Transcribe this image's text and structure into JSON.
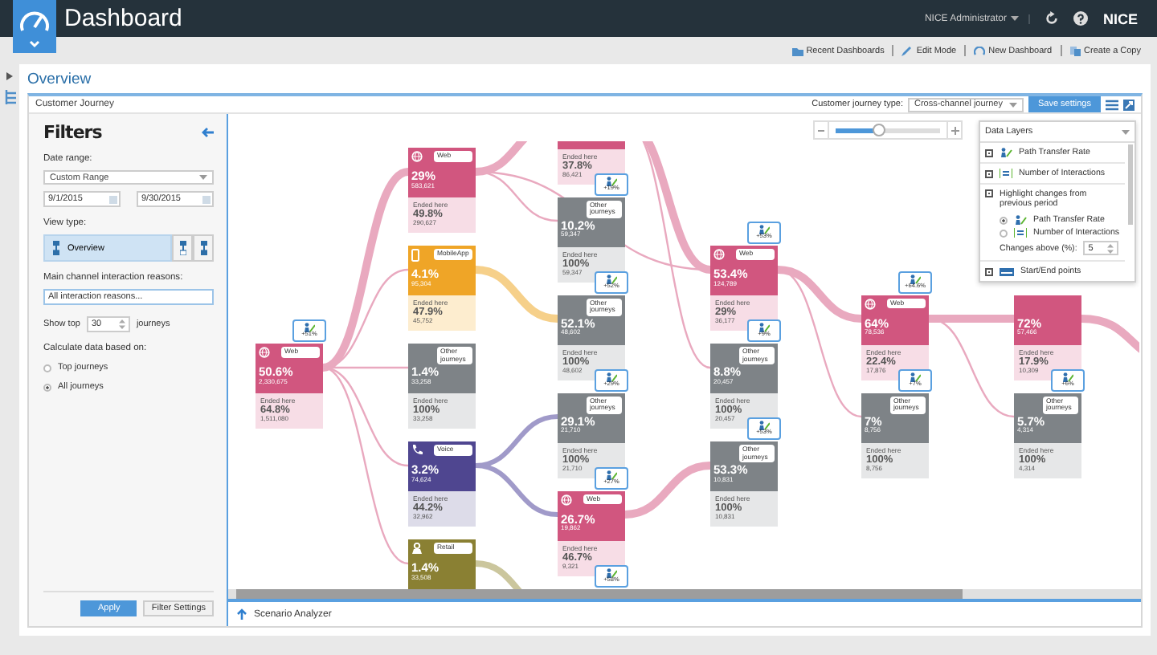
{
  "app": {
    "title": "Dashboard",
    "user": "NICE Administrator",
    "brand": "NICE"
  },
  "toolbar": [
    {
      "label": "Recent Dashboards"
    },
    {
      "label": "Edit Mode"
    },
    {
      "label": "New Dashboard"
    },
    {
      "label": "Create a Copy"
    }
  ],
  "page_title": "Overview",
  "panel": {
    "title": "Customer Journey",
    "type_label": "Customer journey type:",
    "type_value": "Cross-channel journey",
    "save": "Save settings"
  },
  "filters": {
    "title": "Filters",
    "date_label": "Date range:",
    "range": "Custom Range",
    "from": "9/1/2015",
    "to": "9/30/2015",
    "view_label": "View type:",
    "views": [
      {
        "label": "Overview",
        "selected": true
      },
      {
        "selected": false
      },
      {
        "selected": false
      }
    ],
    "reasons_label": "Main channel interaction reasons:",
    "reasons_value": "All interaction reasons...",
    "show_top": "Show top",
    "top_value": "30",
    "journeys": "journeys",
    "calc_label": "Calculate data based on:",
    "calc_options": [
      {
        "label": "Top journeys",
        "selected": false
      },
      {
        "label": "All journeys",
        "selected": true
      }
    ],
    "apply": "Apply",
    "settings": "Filter Settings"
  },
  "zoom": {
    "level": 0.42
  },
  "data_layers": {
    "title": "Data Layers",
    "path_rate": {
      "label": "Path Transfer Rate",
      "checked": true
    },
    "interactions": {
      "label": "Number of Interactions",
      "checked": true
    },
    "highlight": {
      "label": "Highlight changes from previous period",
      "checked": true,
      "options": [
        {
          "label": "Path Transfer Rate",
          "selected": true
        },
        {
          "label": "Number of Interactions",
          "selected": false
        }
      ],
      "threshold_label": "Changes above (%):",
      "threshold": "5"
    },
    "start_end": {
      "label": "Start/End points",
      "checked": true
    }
  },
  "columns": [
    {
      "nodes": [
        {
          "kind": "web",
          "label": "Web",
          "percent": "50.6%",
          "count": "2,330,675",
          "ended_label": "Ended here",
          "ended_percent": "64.8%",
          "ended_count": "1,511,080",
          "badge": "+51%"
        }
      ]
    },
    {
      "nodes": [
        {
          "kind": "web",
          "label": "Web",
          "percent": "29%",
          "count": "583,621",
          "ended_label": "Ended here",
          "ended_percent": "49.8%",
          "ended_count": "290,627"
        },
        {
          "kind": "mobile",
          "label": "MobileApp",
          "percent": "4.1%",
          "count": "95,304",
          "ended_label": "Ended here",
          "ended_percent": "47.9%",
          "ended_count": "45,752"
        },
        {
          "kind": "other",
          "label": "Other journeys",
          "percent": "1.4%",
          "count": "33,258",
          "ended_label": "Ended here",
          "ended_percent": "100%",
          "ended_count": "33,258"
        },
        {
          "kind": "voice",
          "label": "Voice",
          "percent": "3.2%",
          "count": "74,624",
          "ended_label": "Ended here",
          "ended_percent": "44.2%",
          "ended_count": "32,962"
        },
        {
          "kind": "retail",
          "label": "Retail",
          "percent": "1.4%",
          "count": "33,508"
        }
      ]
    },
    {
      "nodes": [
        {
          "kind": "web",
          "ended_label": "Ended here",
          "ended_percent": "37.8%",
          "ended_count": "86,421"
        },
        {
          "kind": "other",
          "label": "Other journeys",
          "percent": "10.2%",
          "count": "59,347",
          "ended_label": "Ended here",
          "ended_percent": "100%",
          "ended_count": "59,347",
          "badge": "+19%"
        },
        {
          "kind": "other",
          "label": "Other journeys",
          "percent": "52.1%",
          "count": "48,602",
          "ended_label": "Ended here",
          "ended_percent": "100%",
          "ended_count": "48,602",
          "badge": "+52%"
        },
        {
          "kind": "other",
          "label": "Other journeys",
          "percent": "29.1%",
          "count": "21,710",
          "ended_label": "Ended here",
          "ended_percent": "100%",
          "ended_count": "21,710",
          "badge": "+29%"
        },
        {
          "kind": "web",
          "label": "Web",
          "percent": "26.7%",
          "count": "19,862",
          "ended_label": "Ended here",
          "ended_percent": "46.7%",
          "ended_count": "9,321",
          "badge": "+27%"
        },
        {
          "badge": "+58%"
        }
      ]
    },
    {
      "nodes": [
        {
          "kind": "web",
          "label": "Web",
          "percent": "53.4%",
          "count": "124,789",
          "ended_label": "Ended here",
          "ended_percent": "29%",
          "ended_count": "36,177",
          "badge": "+53%"
        },
        {
          "kind": "other",
          "label": "Other journeys",
          "percent": "8.8%",
          "count": "20,457",
          "ended_label": "Ended here",
          "ended_percent": "100%",
          "ended_count": "20,457",
          "badge": "+9%"
        },
        {
          "kind": "other",
          "label": "Other journeys",
          "percent": "53.3%",
          "count": "10,831",
          "ended_label": "Ended here",
          "ended_percent": "100%",
          "ended_count": "10,831",
          "badge": "+53%"
        }
      ]
    },
    {
      "nodes": [
        {
          "kind": "web",
          "label": "Web",
          "percent": "64%",
          "count": "78,536",
          "ended_label": "Ended here",
          "ended_percent": "22.4%",
          "ended_count": "17,876",
          "badge": "+64.6%"
        },
        {
          "kind": "other",
          "label": "Other journeys",
          "percent": "7%",
          "count": "8,756",
          "ended_label": "Ended here",
          "ended_percent": "100%",
          "ended_count": "8,756",
          "badge": "+7%"
        }
      ]
    },
    {
      "nodes": [
        {
          "kind": "web",
          "percent": "72%",
          "count": "57,466",
          "ended_label": "Ended here",
          "ended_percent": "17.9%",
          "ended_count": "10,309"
        },
        {
          "kind": "other",
          "label": "Other journeys",
          "percent": "5.7%",
          "count": "4,314",
          "ended_label": "Ended here",
          "ended_percent": "100%",
          "ended_count": "4,314",
          "badge": "+6%"
        }
      ]
    }
  ],
  "footer": {
    "label": "Scenario Analyzer"
  }
}
